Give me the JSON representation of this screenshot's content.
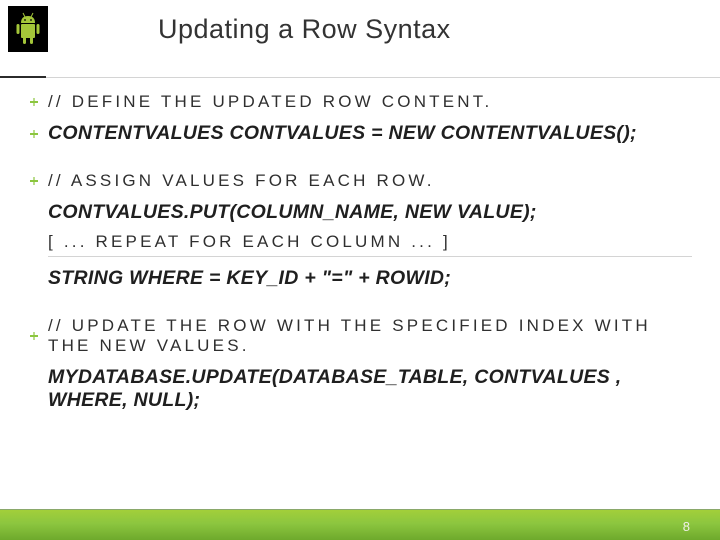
{
  "header": {
    "title": "Updating a Row Syntax"
  },
  "lines": {
    "l1": "// DEFINE THE UPDATED ROW CONTENT.",
    "l2": "CONTENTVALUES CONTVALUES = NEW CONTENTVALUES();",
    "l3": "// ASSIGN VALUES FOR EACH ROW.",
    "l4": "CONTVALUES.PUT(COLUMN_NAME, NEW VALUE);",
    "l5": "[ ... REPEAT FOR EACH COLUMN ... ]",
    "l6": "STRING WHERE = KEY_ID + \"=\" + ROWID;",
    "l7": "// UPDATE THE ROW WITH THE SPECIFIED INDEX WITH THE NEW VALUES.",
    "l8": "MYDATABASE.UPDATE(DATABASE_TABLE, CONTVALUES , WHERE, NULL);"
  },
  "page_number": "8"
}
